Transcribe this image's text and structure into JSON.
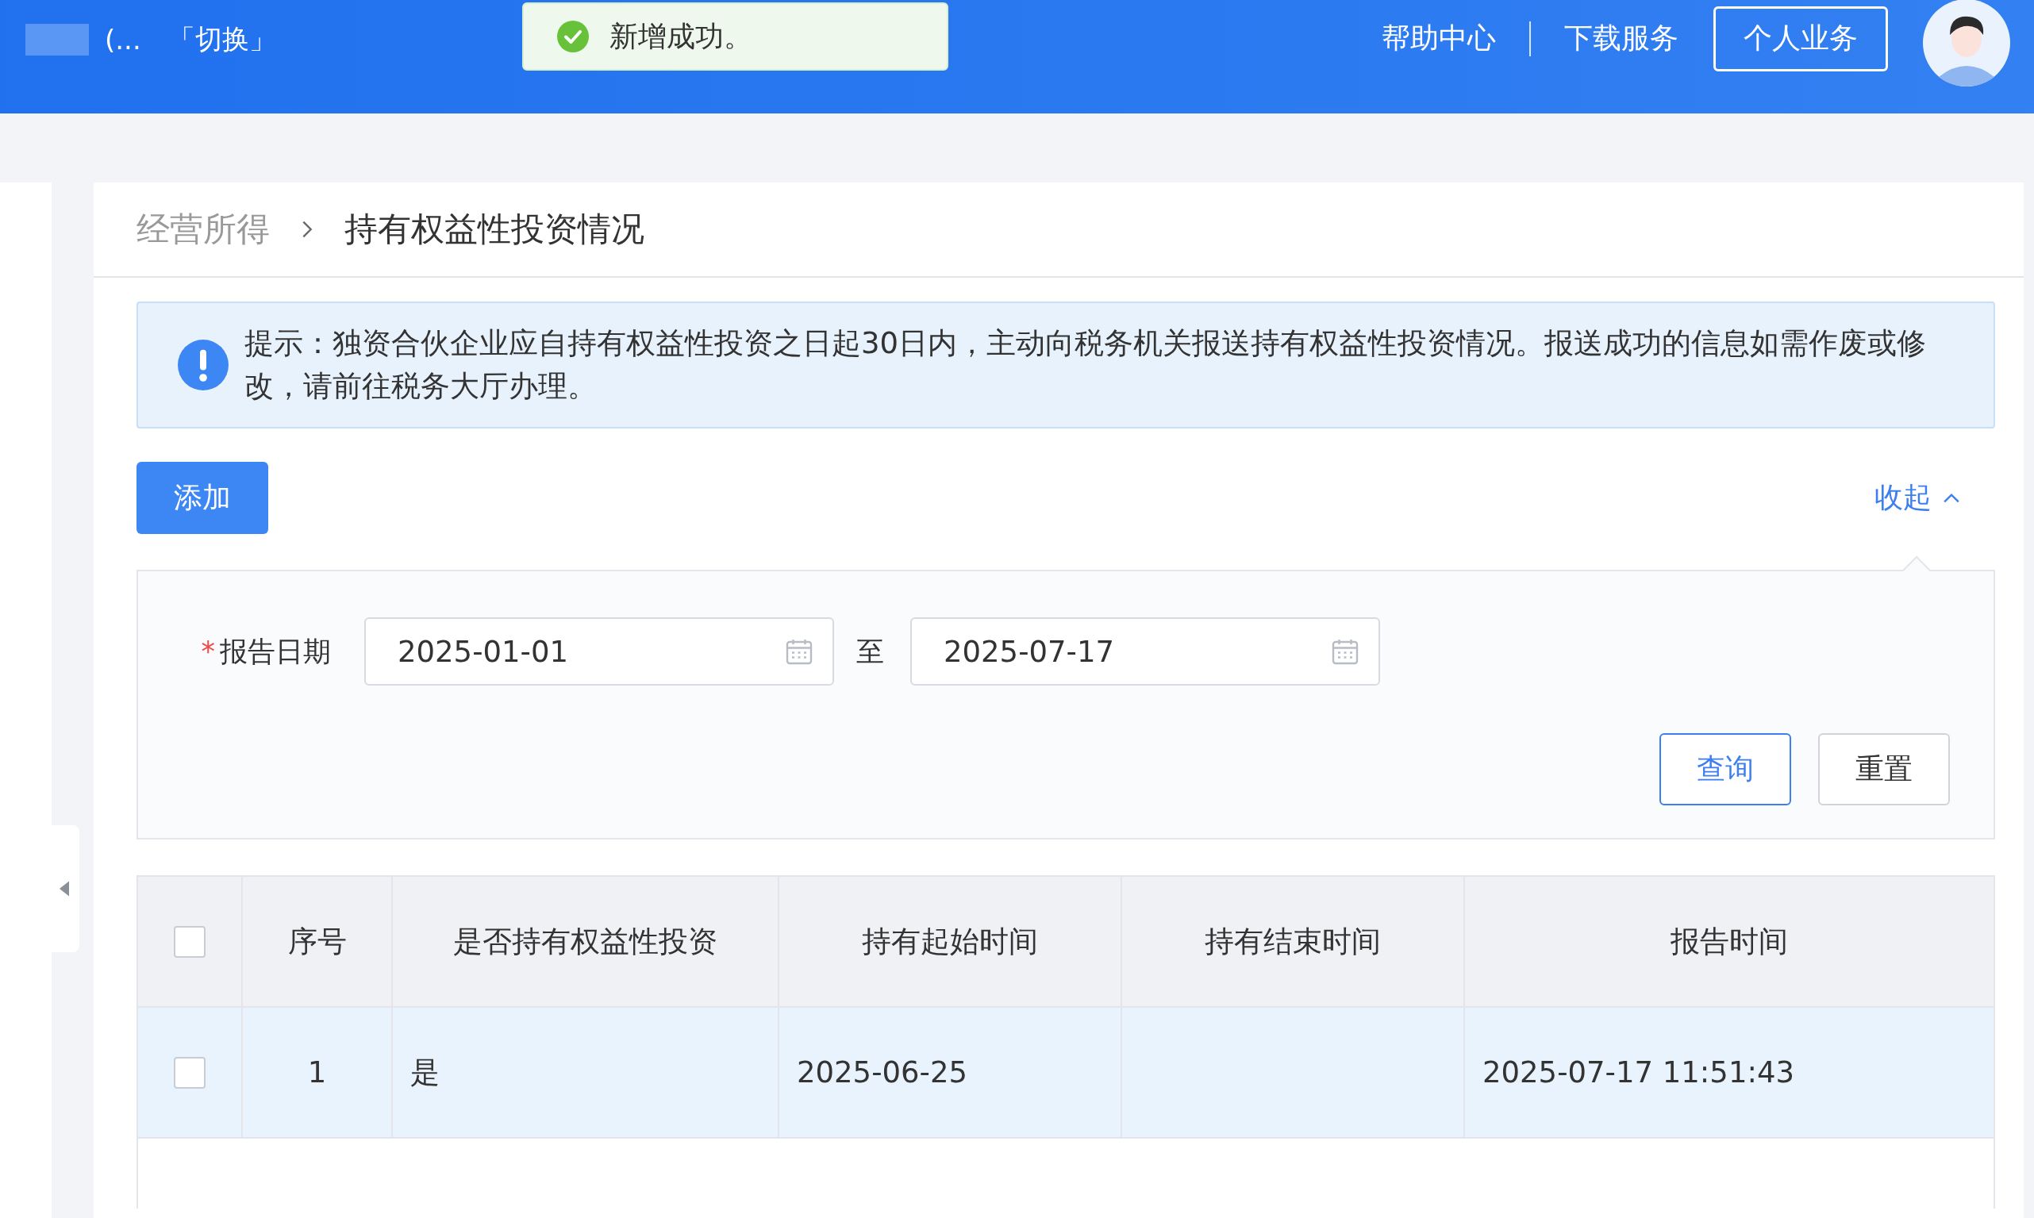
{
  "header": {
    "account": {
      "ellipsis": "(...",
      "switch_link": "「切换」"
    },
    "toast": {
      "message": "新增成功。"
    },
    "links": [
      "帮助中心",
      "下载服务"
    ],
    "personal_button": "个人业务"
  },
  "breadcrumb": [
    {
      "label": "经营所得",
      "current": false
    },
    {
      "label": "持有权益性投资情况",
      "current": true
    }
  ],
  "notice": {
    "text": "提示：独资合伙企业应自持有权益性投资之日起30日内，主动向税务机关报送持有权益性投资情况。报送成功的信息如需作废或修改，请前往税务大厅办理。"
  },
  "add_button": "添加",
  "collapse_link": "收起",
  "filter": {
    "label": "报告日期",
    "required_mark": "*",
    "from": "2025-01-01",
    "separator": "至",
    "to": "2025-07-17",
    "buttons": [
      {
        "label": "查询",
        "kind": "primary"
      },
      {
        "label": "重置",
        "kind": "default"
      }
    ]
  },
  "table": {
    "all_checked": false,
    "columns": [
      "序号",
      "是否持有权益性投资",
      "持有起始时间",
      "持有结束时间",
      "报告时间"
    ],
    "rows": [
      {
        "checked": false,
        "selected": true,
        "index": "1",
        "holds_investment": "是",
        "start_time": "2025-06-25",
        "report_time": "2025-07-17 11:51:43"
      }
    ]
  }
}
